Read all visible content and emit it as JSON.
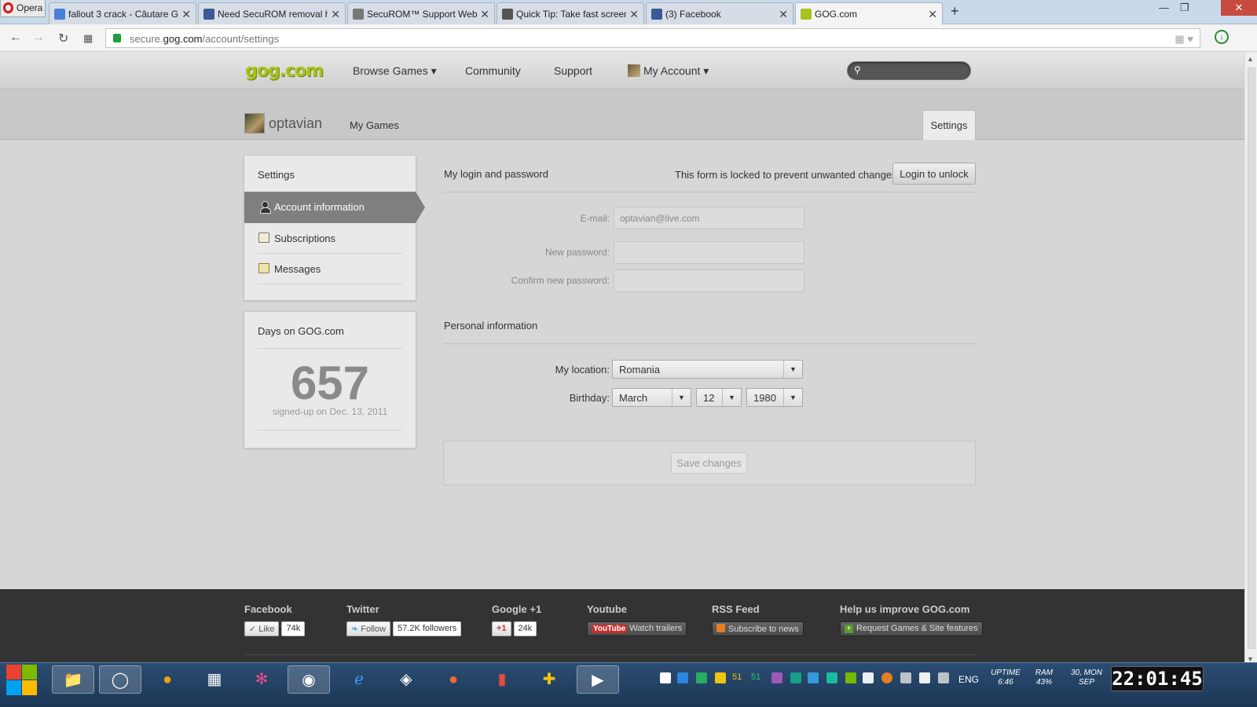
{
  "browser": {
    "opera_label": "Opera",
    "tabs": [
      {
        "label": "fallout 3 crack - Căutare G",
        "icon_color": "#4a7fd6"
      },
      {
        "label": "Need SecuROM removal h",
        "icon_color": "#3c5a99"
      },
      {
        "label": "SecuROM™ Support Webs",
        "icon_color": "#777777"
      },
      {
        "label": "Quick Tip: Take fast screen",
        "icon_color": "#555555"
      },
      {
        "label": "(3) Facebook",
        "icon_color": "#3b5998"
      },
      {
        "label": "GOG.com",
        "icon_color": "#a9c21d"
      }
    ],
    "url_prefix": "secure.",
    "url_host": "gog.com",
    "url_path": "/account/settings"
  },
  "gog": {
    "logo": "gog.com",
    "nav": [
      "Browse Games ▾",
      "Community",
      "Support",
      "My Account ▾"
    ],
    "search_icon": "search-icon"
  },
  "account": {
    "username": "optavian",
    "my_games": "My Games",
    "settings_tab": "Settings"
  },
  "sidebar": {
    "title": "Settings",
    "items": [
      {
        "label": "Account information",
        "icon": "user-icon"
      },
      {
        "label": "Subscriptions",
        "icon": "subscriptions-icon"
      },
      {
        "label": "Messages",
        "icon": "messages-icon"
      }
    ]
  },
  "days": {
    "title": "Days on GOG.com",
    "count": "657",
    "signup": "signed-up on Dec. 13, 2011"
  },
  "login": {
    "title": "My login and password",
    "locked_msg": "This form is locked to prevent unwanted changes.",
    "unlock_label": "Login to unlock",
    "email_label": "E-mail:",
    "email_value": "optavian@live.com",
    "newpw_label": "New password:",
    "confirmpw_label": "Confirm new password:"
  },
  "personal": {
    "title": "Personal information",
    "location_label": "My location:",
    "location_value": "Romania",
    "birthday_label": "Birthday:",
    "month": "March",
    "day": "12",
    "year": "1980",
    "save_label": "Save changes"
  },
  "footer": {
    "facebook": {
      "title": "Facebook",
      "btn": "✓ Like",
      "count": "74k"
    },
    "twitter": {
      "title": "Twitter",
      "btn": "Follow",
      "count": "57.2K followers"
    },
    "google": {
      "title": "Google +1",
      "btn": "+1",
      "count": "24k"
    },
    "youtube": {
      "title": "Youtube",
      "logo": "YouTube",
      "btn": "Watch trailers"
    },
    "rss": {
      "title": "RSS Feed",
      "btn": "Subscribe to news"
    },
    "improve": {
      "title": "Help us improve GOG.com",
      "btn": "Request Games & Site features"
    }
  },
  "taskbar": {
    "lang": "ENG",
    "uptime_label": "UPTIME",
    "uptime_value": "6:46",
    "ram_label": "RAM",
    "ram_value": "43%",
    "date_line1": "30, MON",
    "date_line2": "SEP",
    "clock": "22:01:45",
    "tray_num1": "51",
    "tray_num2": "51"
  }
}
